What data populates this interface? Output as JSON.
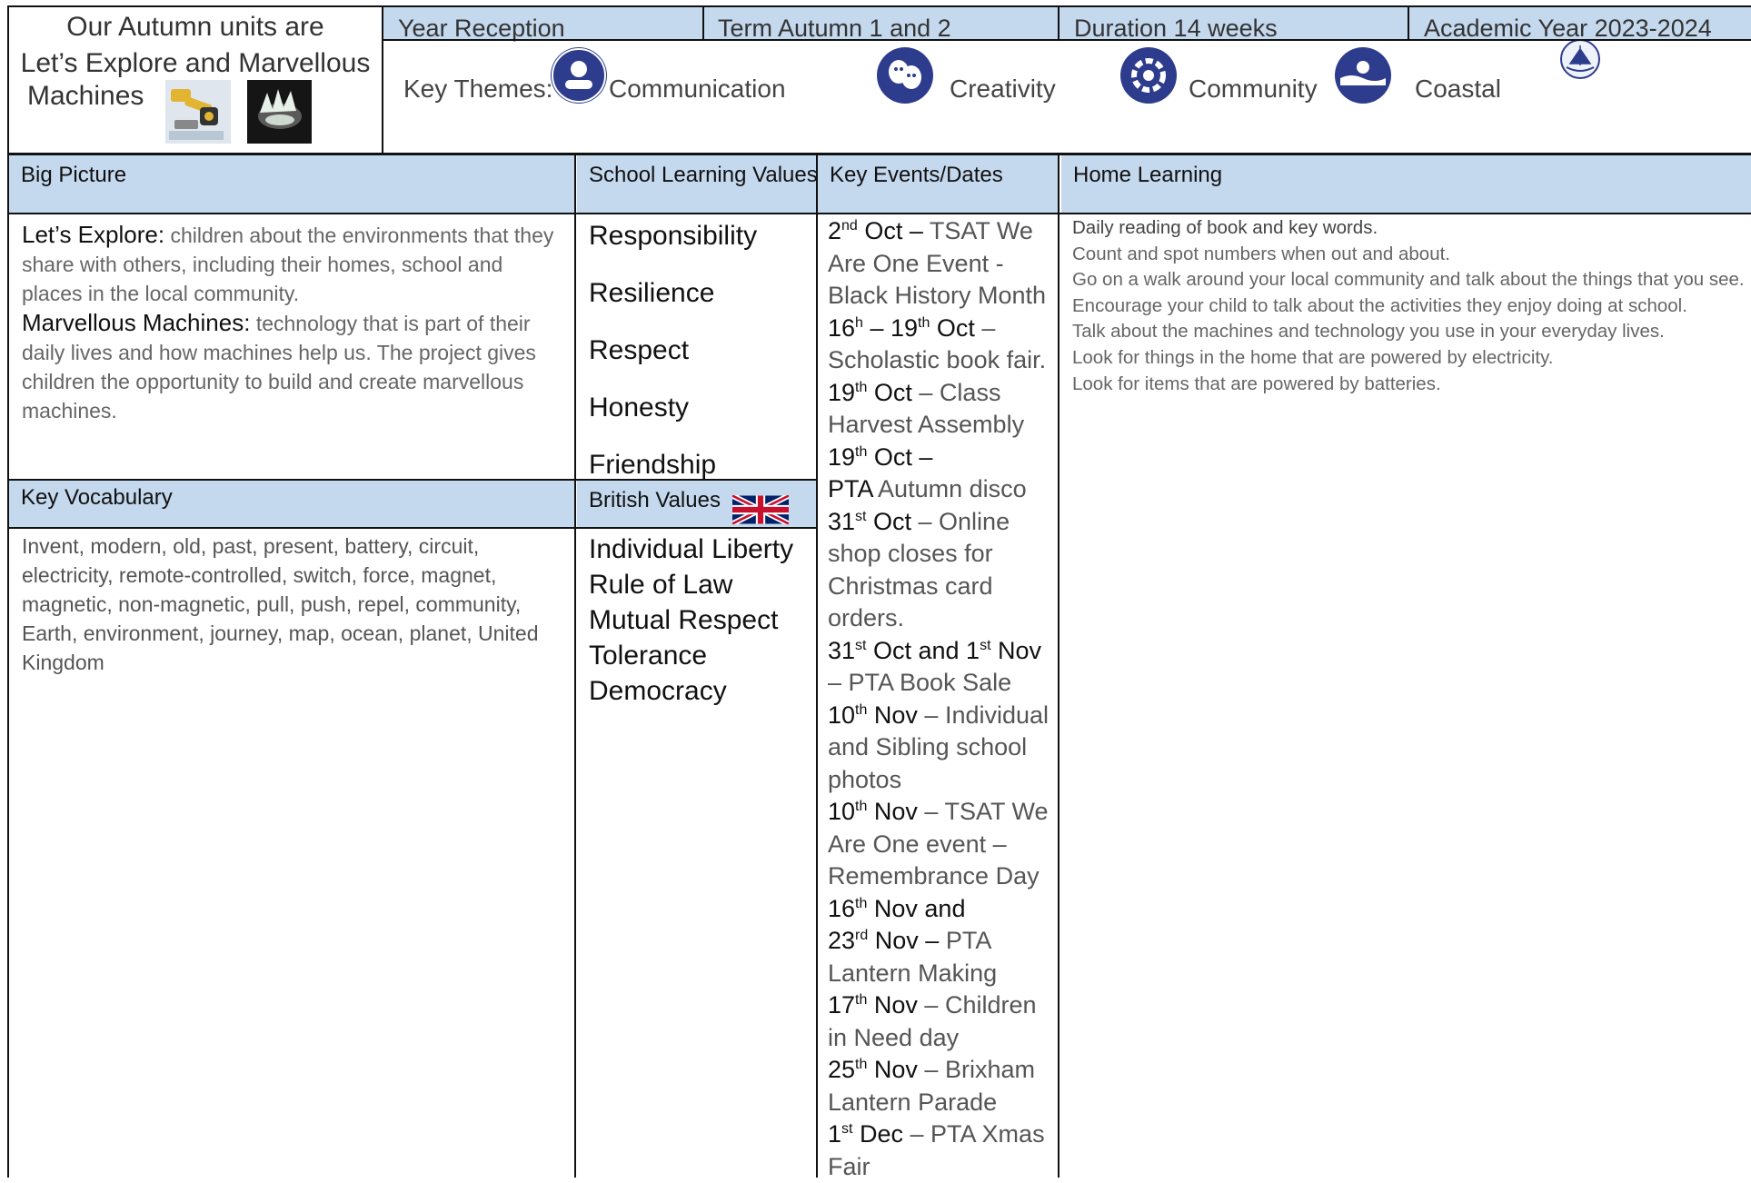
{
  "header": {
    "title_line1": "Our Autumn units are",
    "title_line2": "Let’s Explore and Marvellous",
    "title_line3": "Machines",
    "year": "Year Reception",
    "term": "Term Autumn 1 and 2",
    "duration": "Duration 14 weeks",
    "academic_year": "Academic Year 2023-2024",
    "key_themes_label": "Key Themes:",
    "themes": [
      {
        "label": "Communication",
        "icon": "communication-icon"
      },
      {
        "label": "Creativity",
        "icon": "theatre-masks-icon"
      },
      {
        "label": "Community",
        "icon": "community-icon"
      },
      {
        "label": "Coastal",
        "icon": "coastal-icon"
      }
    ]
  },
  "big_picture": {
    "heading": "Big Picture",
    "p1_lead": "Let’s Explore:",
    "p1_text": " children about the environments that they share with others, including their homes, school and places in the local community.",
    "p2_lead": "Marvellous Machines:",
    "p2_text": "  technology that is part of their daily lives and how machines help us. The project gives children the opportunity to build and create marvellous machines."
  },
  "school_values": {
    "heading": "School Learning Values",
    "items": [
      "Responsibility",
      "Resilience",
      "Respect",
      "Honesty",
      "Friendship"
    ]
  },
  "british_values": {
    "heading": "British Values",
    "items": [
      "Individual Liberty",
      "Rule of Law",
      "Mutual Respect",
      "Tolerance",
      "Democracy"
    ]
  },
  "key_vocabulary": {
    "heading": "Key Vocabulary",
    "text": "Invent, modern, old, past, present, battery, circuit, electricity, remote-controlled, switch, force, magnet, magnetic, non-magnetic, pull, push, repel, community, Earth, environment, journey, map, ocean, planet, United Kingdom"
  },
  "key_events": {
    "heading": "Key Events/Dates",
    "items": [
      {
        "d1": "2",
        "s1": "nd",
        "d1b": " Oct –",
        "text": " TSAT We Are One Event - Black History Month"
      },
      {
        "d1": "16",
        "s1": "h",
        "d1b": " – 19",
        "s2": "th",
        "d1c": " Oct",
        "text": " – Scholastic book fair."
      },
      {
        "d1": "19",
        "s1": "th",
        "d1b": " Oct",
        "text": " – Class Harvest Assembly"
      },
      {
        "d1": "19",
        "s1": "th",
        "d1b": " Oct –",
        "text2_lead": "PTA",
        "text": " Autumn disco"
      },
      {
        "d1": "31",
        "s1": "st",
        "d1b": " Oct",
        "text": " – Online shop closes for Christmas card orders."
      },
      {
        "d1": "31",
        "s1": "st",
        "d1b": " Oct and 1",
        "s2": "st",
        "d1c": " Nov",
        "text": " – PTA Book Sale"
      },
      {
        "d1": "10",
        "s1": "th",
        "d1b": " Nov",
        "text": " – Individual and Sibling school photos"
      },
      {
        "d1": "10",
        "s1": "th",
        "d1b": " Nov",
        "text": " – TSAT We Are One event – Remembrance Day"
      },
      {
        "d1": "16",
        "s1": "th",
        "d1b": " Nov and",
        "d2": "23",
        "s2": "rd",
        "d2b": " Nov –",
        "text": " PTA Lantern Making"
      },
      {
        "d1": "17",
        "s1": "th",
        "d1b": " Nov",
        "text": " – Children in Need day"
      },
      {
        "d1": "25",
        "s1": "th",
        "d1b": " Nov",
        "text": " – Brixham Lantern Parade"
      },
      {
        "d1": "1",
        "s1": "st",
        "d1b": " Dec",
        "text": " – PTA Xmas Fair"
      }
    ]
  },
  "home_learning": {
    "heading": "Home Learning",
    "items": [
      "Daily reading of book and key words.",
      "Count and spot numbers when out and about.",
      "Go on a walk around your local community and talk about the things that you see.",
      "Encourage your child to talk about the activities they enjoy doing at school.",
      "Talk about the machines and technology you use in your everyday lives.",
      "Look for things in the home that are powered by electricity.",
      "Look for items that are powered by batteries."
    ]
  },
  "colors": {
    "header_blue": "#c4d8ee",
    "icon_navy": "#2d3c8c"
  }
}
